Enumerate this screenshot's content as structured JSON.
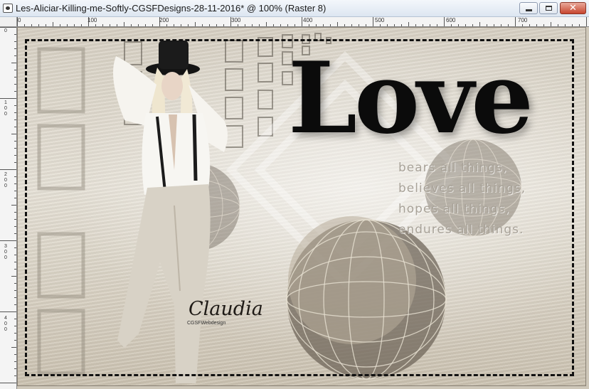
{
  "window": {
    "title": "Les-Aliciar-Killing-me-Softly-CGSFDesigns-28-11-2016* @ 100% (Raster 8)",
    "minimize_icon": "minimize-icon",
    "maximize_icon": "maximize-icon",
    "close_icon": "close-icon",
    "close_color": "#c7452e"
  },
  "ruler": {
    "horizontal_labels": [
      "0",
      "100",
      "200",
      "300",
      "400",
      "500",
      "600",
      "700"
    ],
    "vertical_labels": [
      "0",
      "100",
      "200",
      "300",
      "400"
    ]
  },
  "artwork": {
    "headline": "Love",
    "verse": [
      "bears all things,",
      "believes all things,",
      "hopes all things,",
      "endures all things."
    ],
    "signature": "Claudia",
    "credit": "CGSFWebdesign"
  }
}
